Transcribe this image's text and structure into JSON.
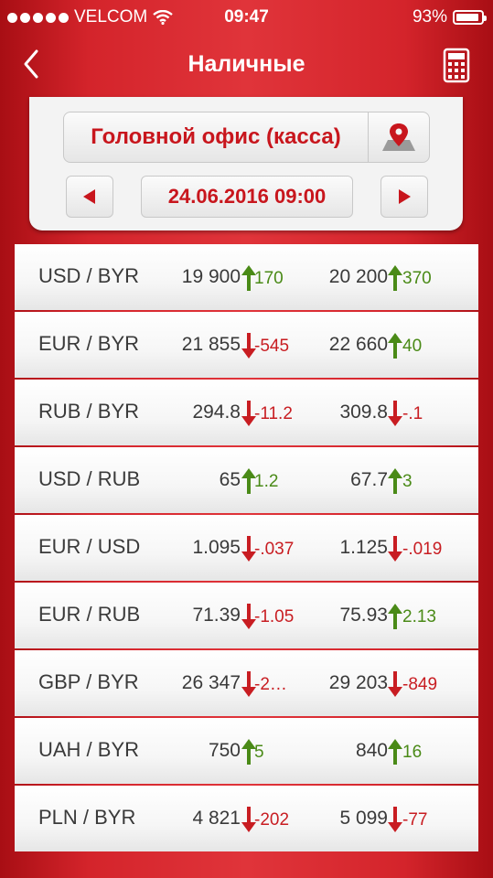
{
  "status": {
    "carrier": "VELCOM",
    "time": "09:47",
    "battery": "93%",
    "battery_level": 0.93
  },
  "nav": {
    "title": "Наличные",
    "back_icon": "chevron-left-icon",
    "calc_icon": "calculator-icon"
  },
  "office": {
    "name": "Головной офис (касса)",
    "pin_icon": "map-pin-icon"
  },
  "date": {
    "value": "24.06.2016 09:00",
    "prev_icon": "triangle-left-icon",
    "next_icon": "triangle-right-icon"
  },
  "colors": {
    "accent": "#c8161d",
    "up": "#4a8a17",
    "down": "#c81d22"
  },
  "rates": [
    {
      "pair": "USD / BYR",
      "buy": "19 900",
      "buy_dir": "up",
      "buy_chg": "170",
      "sell": "20 200",
      "sell_dir": "up",
      "sell_chg": "370"
    },
    {
      "pair": "EUR / BYR",
      "buy": "21 855",
      "buy_dir": "down",
      "buy_chg": "-545",
      "sell": "22 660",
      "sell_dir": "up",
      "sell_chg": "40"
    },
    {
      "pair": "RUB / BYR",
      "buy": "294.8",
      "buy_dir": "down",
      "buy_chg": "-11.2",
      "sell": "309.8",
      "sell_dir": "down",
      "sell_chg": "-.1"
    },
    {
      "pair": "USD / RUB",
      "buy": "65",
      "buy_dir": "up",
      "buy_chg": "1.2",
      "sell": "67.7",
      "sell_dir": "up",
      "sell_chg": "3"
    },
    {
      "pair": "EUR / USD",
      "buy": "1.095",
      "buy_dir": "down",
      "buy_chg": "-.037",
      "sell": "1.125",
      "sell_dir": "down",
      "sell_chg": "-.019"
    },
    {
      "pair": "EUR / RUB",
      "buy": "71.39",
      "buy_dir": "down",
      "buy_chg": "-1.05",
      "sell": "75.93",
      "sell_dir": "up",
      "sell_chg": "2.13"
    },
    {
      "pair": "GBP / BYR",
      "buy": "26 347",
      "buy_dir": "down",
      "buy_chg": "-2…",
      "sell": "29 203",
      "sell_dir": "down",
      "sell_chg": "-849"
    },
    {
      "pair": "UAH / BYR",
      "buy": "750",
      "buy_dir": "up",
      "buy_chg": "5",
      "sell": "840",
      "sell_dir": "up",
      "sell_chg": "16"
    },
    {
      "pair": "PLN / BYR",
      "buy": "4 821",
      "buy_dir": "down",
      "buy_chg": "-202",
      "sell": "5 099",
      "sell_dir": "down",
      "sell_chg": "-77"
    }
  ]
}
